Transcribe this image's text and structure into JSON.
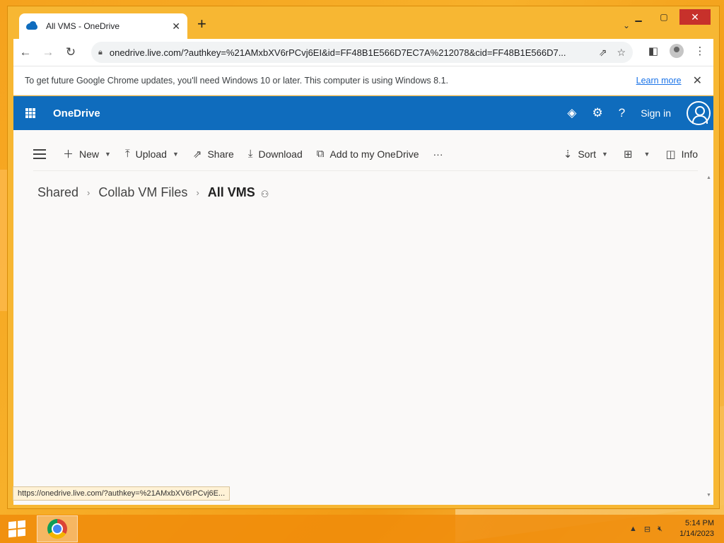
{
  "browser": {
    "tab_title": "All VMS - OneDrive",
    "tab_close": "✕",
    "new_tab": "+",
    "tab_menu": "⌄",
    "url": "onedrive.live.com/?authkey=%21AMxbXV6rPCvj6EI&id=FF48B1E566D7EC7A%212078&cid=FF48B1E566D7...",
    "status_url": "https://onedrive.live.com/?authkey=%21AMxbXV6rPCvj6E..."
  },
  "infobar": {
    "message": "To get future Google Chrome updates, you'll need Windows 10 or later. This computer is using Windows 8.1.",
    "link": "Learn more",
    "close": "✕"
  },
  "header": {
    "brand": "OneDrive",
    "sign_in": "Sign in"
  },
  "commands": {
    "new": "New",
    "upload": "Upload",
    "share": "Share",
    "download": "Download",
    "add_to_onedrive": "Add to my OneDrive",
    "more": "···",
    "sort": "Sort",
    "info": "Info"
  },
  "breadcrumb": {
    "items": [
      "Shared",
      "Collab VM Files"
    ],
    "current": "All VMS"
  },
  "taskbar": {
    "time": "5:14 PM",
    "date": "1/14/2023"
  }
}
